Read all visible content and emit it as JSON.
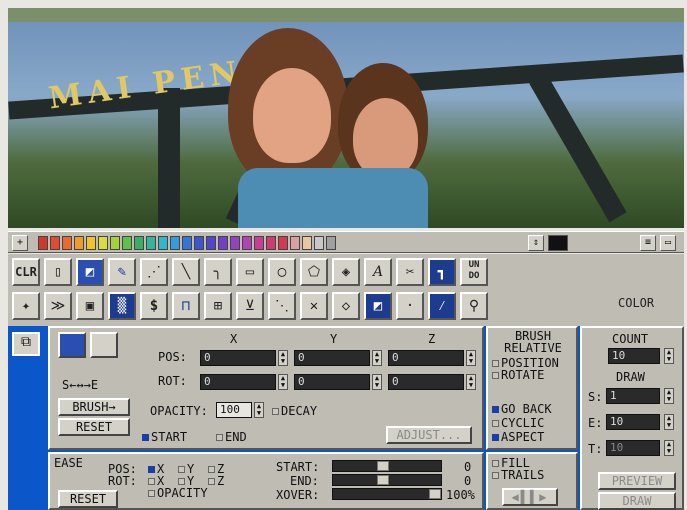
{
  "palette": {
    "colors": [
      "#d0382c",
      "#e24b2f",
      "#e86a2c",
      "#f09a2a",
      "#f1c22a",
      "#d9dc3a",
      "#a5d23b",
      "#5fc04a",
      "#3aad68",
      "#35b49b",
      "#34b6c8",
      "#359cd8",
      "#3475d6",
      "#3b56cf",
      "#5147c8",
      "#7042c2",
      "#9243be",
      "#b343b3",
      "#c83d95",
      "#cf3b70",
      "#d33a52",
      "#d8a0a0",
      "#e7c7a0",
      "#c8c8c8",
      "#a0a0a0"
    ]
  },
  "tools": {
    "clr": "CLR",
    "undo": "UN DO",
    "color": "COLOR"
  },
  "axes": {
    "x": "X",
    "y": "Y",
    "z": "Z"
  },
  "pos": {
    "label": "POS:",
    "x": "0",
    "y": "0",
    "z": "0"
  },
  "rot": {
    "label": "ROT:",
    "x": "0",
    "y": "0",
    "z": "0"
  },
  "opacity": {
    "label": "OPACITY:",
    "value": "100",
    "decay": "DECAY"
  },
  "keys": {
    "se": "S←↔→E",
    "brush": "BRUSH→",
    "reset": "RESET",
    "start": "START",
    "end": "END",
    "adjust": "ADJUST..."
  },
  "brush_rel": {
    "title": "BRUSH RELATIVE",
    "position": "POSITION",
    "rotate": "ROTATE",
    "goback": "GO BACK",
    "cyclic": "CYCLIC",
    "aspect": "ASPECT",
    "fill": "FILL",
    "trails": "TRAILS"
  },
  "count": {
    "title": "COUNT",
    "value": "10",
    "draw": "DRAW",
    "s_label": "S:",
    "s": "1",
    "e_label": "E:",
    "e": "10",
    "t_label": "T:",
    "t": "10"
  },
  "ease": {
    "title": "EASE",
    "pos": "POS:",
    "rot": "ROT:",
    "x": "X",
    "y": "Y",
    "z": "Z",
    "opacity": "OPACITY",
    "reset": "RESET",
    "start": "START:",
    "end": "END:",
    "xover": "XOVER:",
    "start_v": "0",
    "end_v": "0",
    "xover_v": "100%"
  },
  "bottom": {
    "preview": "PREVIEW",
    "draw": "DRAW",
    "playback": "◀▌▌▶"
  },
  "photo": {
    "sign": "MAI PEN"
  }
}
